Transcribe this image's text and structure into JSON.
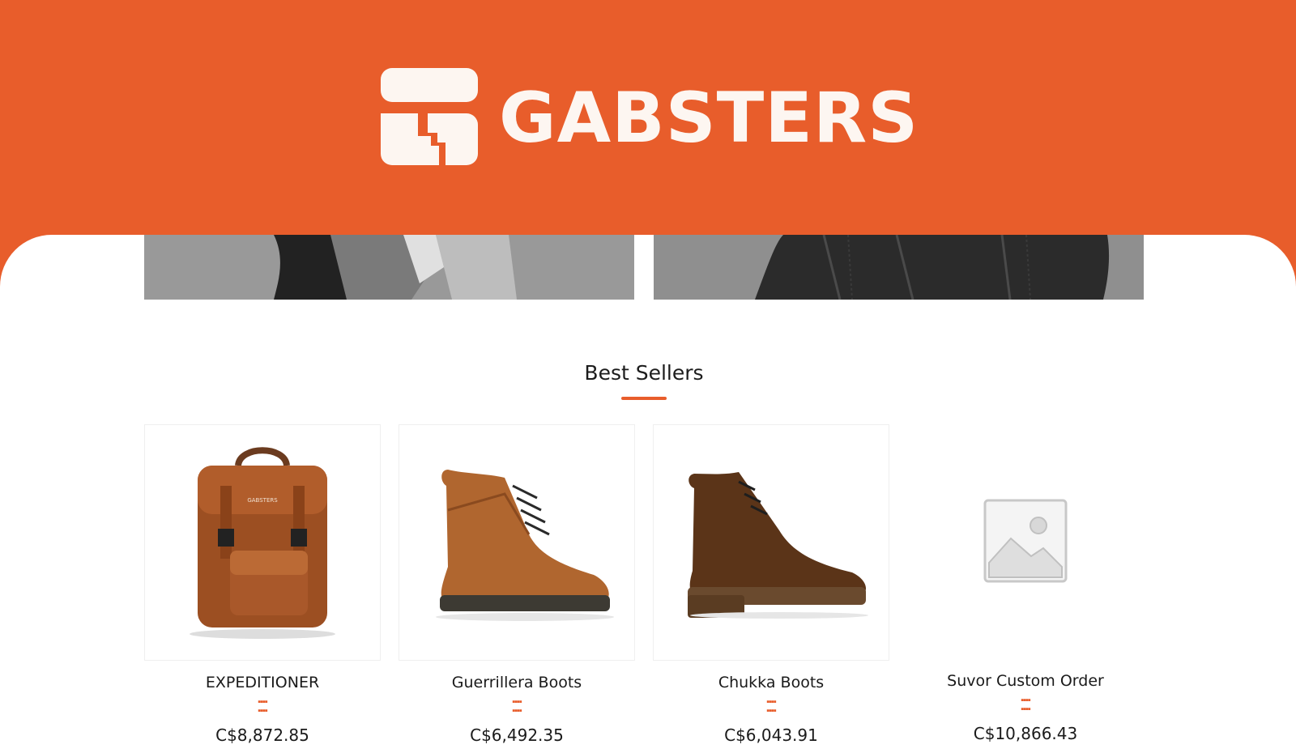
{
  "brand": {
    "name": "GABSTERS",
    "colors": {
      "primary": "#e85d2b",
      "logo_fg": "#fdf6f1"
    },
    "logo_icon": "gabsters-logo-icon"
  },
  "section": {
    "title": "Best Sellers"
  },
  "products": [
    {
      "name": "EXPEDITIONER",
      "price": "C$8,872.85",
      "image_icon": "leather-backpack-image"
    },
    {
      "name": "Guerrillera Boots",
      "price": "C$6,492.35",
      "image_icon": "brown-lace-up-boot-image"
    },
    {
      "name": "Chukka Boots",
      "price": "C$6,043.91",
      "image_icon": "dark-brown-chukka-boot-image"
    },
    {
      "name": "Suvor Custom Order",
      "price": "C$10,866.43",
      "image_icon": "image-placeholder-icon"
    }
  ]
}
